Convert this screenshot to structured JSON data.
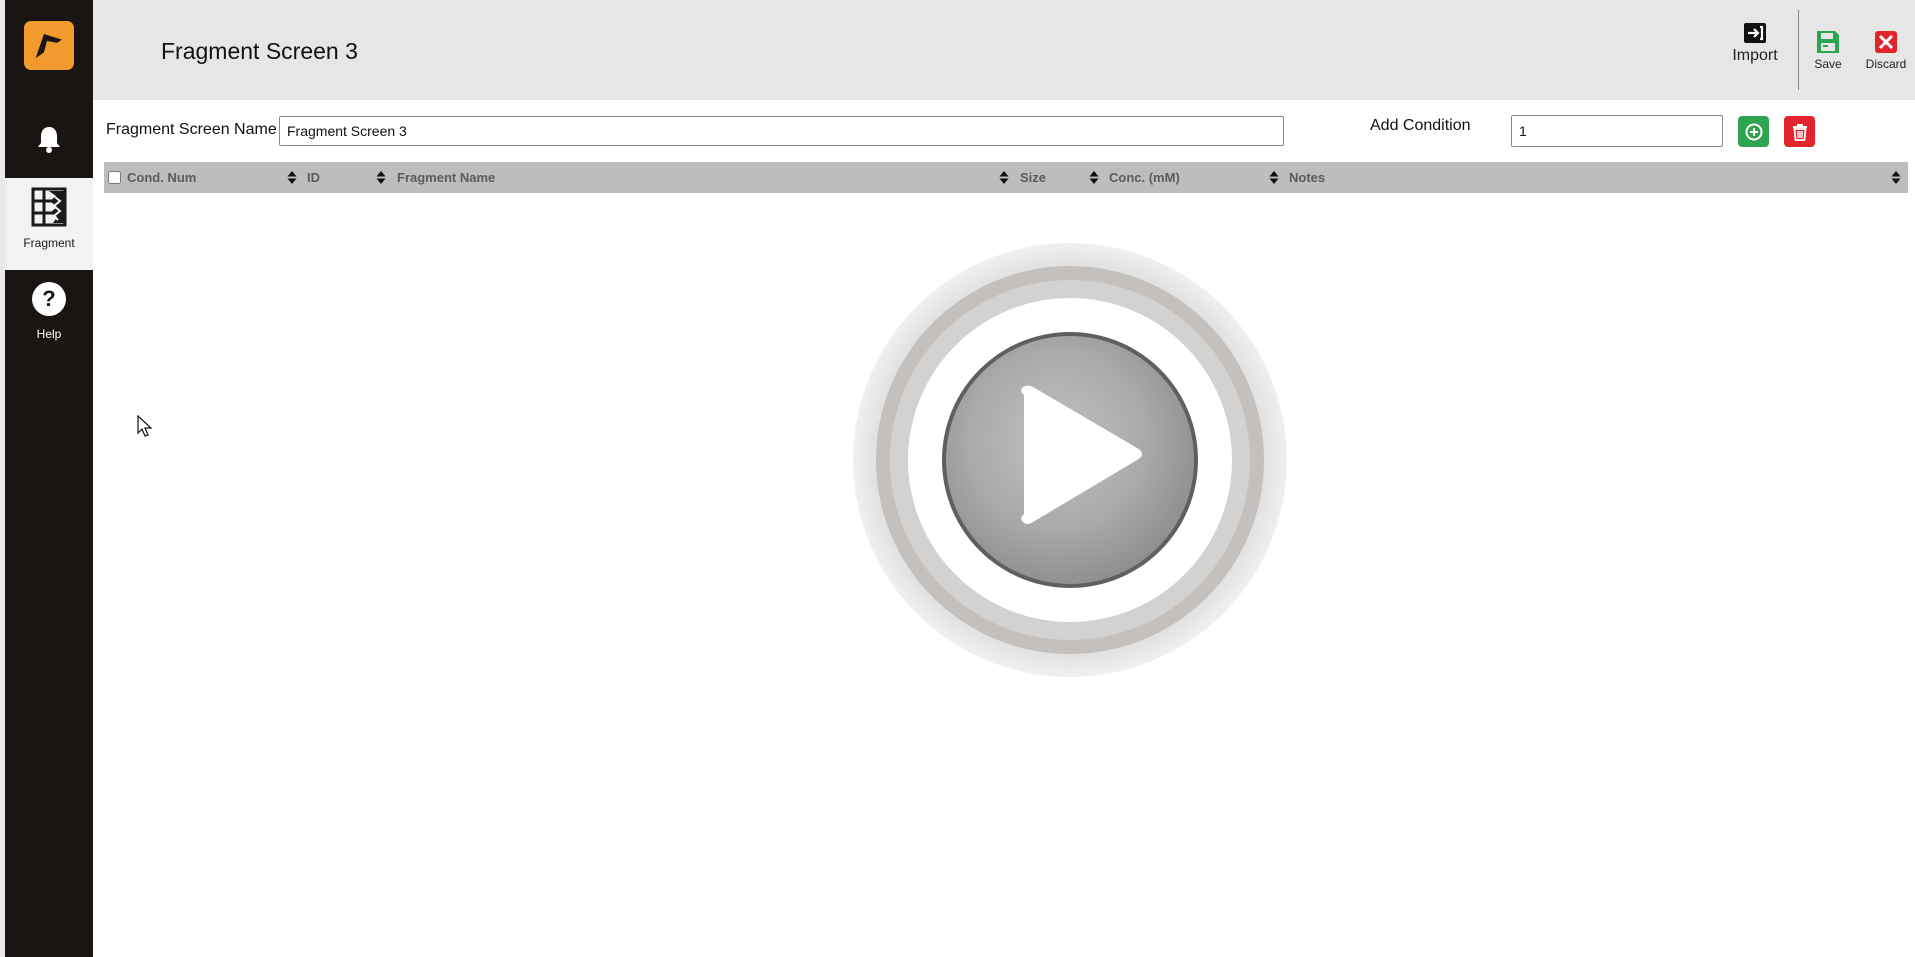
{
  "app": {
    "title": "Fragment Screen 3",
    "colors": {
      "sidebar": "#1a1413",
      "accent": "#f29a2e",
      "header": "#e6e6e6",
      "save": "#2ea44f",
      "discard": "#e0252d",
      "table_header": "#bdbdbd"
    }
  },
  "sidebar": {
    "items": [
      {
        "icon": "bell-icon",
        "label": ""
      },
      {
        "icon": "fragment-grid-icon",
        "label": "Fragment",
        "active": true
      },
      {
        "icon": "help-icon",
        "label": "Help"
      }
    ]
  },
  "toolbar": {
    "import_label": "Import",
    "save_label": "Save",
    "discard_label": "Discard"
  },
  "form": {
    "name_label": "Fragment Screen Name",
    "name_value": "Fragment Screen 3",
    "add_condition_label": "Add Condition",
    "add_condition_value": "1"
  },
  "table": {
    "columns": [
      "Cond. Num",
      "ID",
      "Fragment Name",
      "Size",
      "Conc. (mM)",
      "Notes"
    ],
    "rows": []
  },
  "video_overlay": {
    "icon": "play-icon"
  }
}
